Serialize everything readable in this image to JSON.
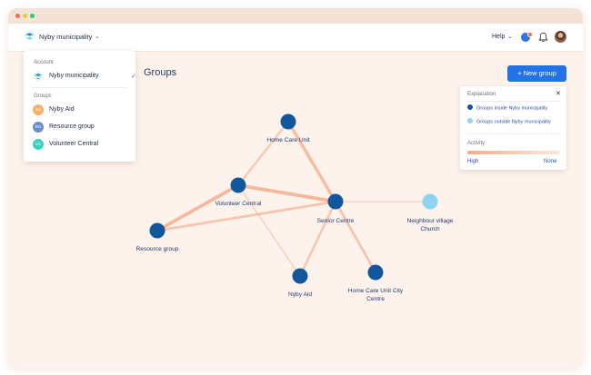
{
  "header": {
    "municipality": "Nyby municipality",
    "help_label": "Help"
  },
  "account_menu": {
    "account_heading": "Account",
    "account_item": "Nyby municipality",
    "groups_heading": "Groups",
    "groups": [
      {
        "initials": "NA",
        "label": "Nyby Aid",
        "color": "#f5b16c"
      },
      {
        "initials": "RG",
        "label": "Resource group",
        "color": "#6b8ec9"
      },
      {
        "initials": "VC",
        "label": "Volunteer Central",
        "color": "#3bd0c0"
      }
    ]
  },
  "page": {
    "title": "Groups",
    "new_group_label": "New group"
  },
  "explanation": {
    "title": "Explanation",
    "inside_label": "Groups inside Nyby municipality",
    "outside_label": "Groups outside Nyby municipality",
    "inside_color": "#12579c",
    "outside_color": "#8fd3f2",
    "activity_label": "Activity",
    "high_label": "High",
    "none_label": "None"
  },
  "graph": {
    "nodes": [
      {
        "id": "hcu",
        "label": [
          "Home Care Unit"
        ],
        "inside": true
      },
      {
        "id": "vc",
        "label": [
          "Volunteer Central"
        ],
        "inside": true
      },
      {
        "id": "sc",
        "label": [
          "Senior Centre"
        ],
        "inside": true
      },
      {
        "id": "nvc",
        "label": [
          "Neighbour village",
          "Church"
        ],
        "inside": false
      },
      {
        "id": "rg",
        "label": [
          "Resource group"
        ],
        "inside": true
      },
      {
        "id": "na",
        "label": [
          "Nyby Aid"
        ],
        "inside": true
      },
      {
        "id": "hcucc",
        "label": [
          "Home Care Unit City",
          "Centre"
        ],
        "inside": true
      }
    ],
    "edges": [
      {
        "from": "hcu",
        "to": "vc",
        "activity": 0.5
      },
      {
        "from": "hcu",
        "to": "sc",
        "activity": 0.8
      },
      {
        "from": "vc",
        "to": "sc",
        "activity": 0.9
      },
      {
        "from": "vc",
        "to": "rg",
        "activity": 0.9
      },
      {
        "from": "rg",
        "to": "sc",
        "activity": 0.6
      },
      {
        "from": "vc",
        "to": "na",
        "activity": 0.25
      },
      {
        "from": "sc",
        "to": "na",
        "activity": 0.55
      },
      {
        "from": "sc",
        "to": "hcucc",
        "activity": 0.6
      },
      {
        "from": "sc",
        "to": "nvc",
        "activity": 0.15
      }
    ]
  }
}
